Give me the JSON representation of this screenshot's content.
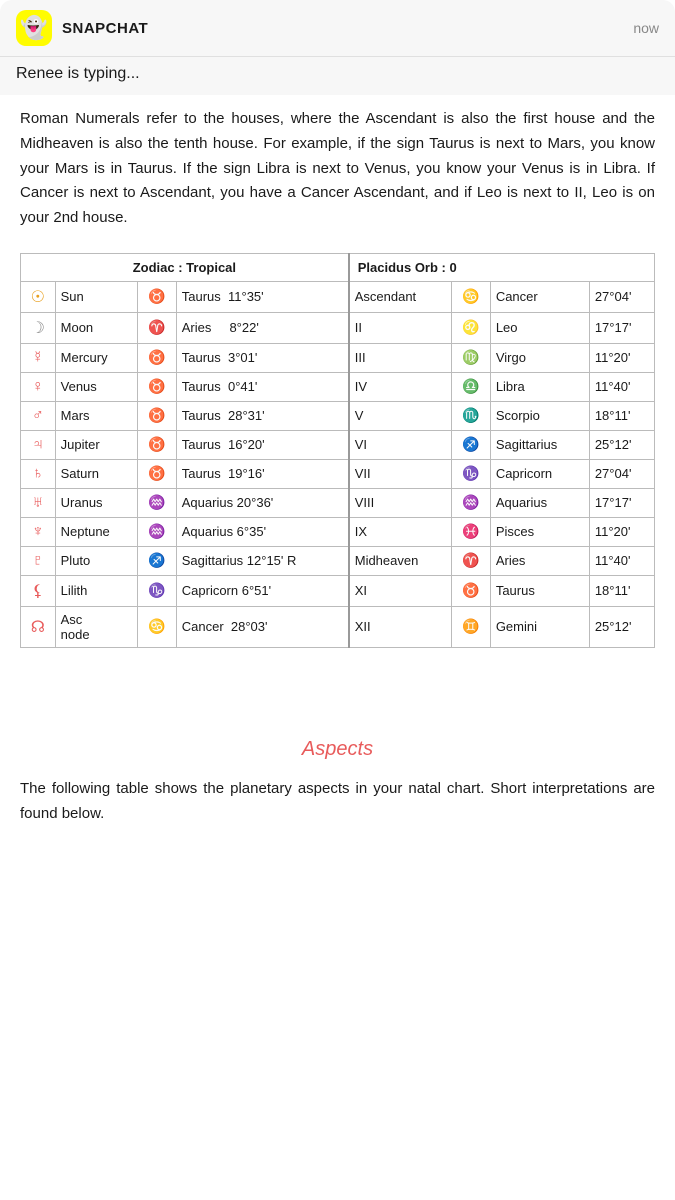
{
  "notification": {
    "app": "SNAPCHAT",
    "time": "now",
    "message": "Renee is typing...",
    "icon": "👻"
  },
  "intro_text": "Roman Numerals refer to the houses, where the Ascendant is also the first house and the Midheaven is also the tenth house. For example, if the sign Taurus is next to Mars, you know your Mars is in Taurus. If the sign Libra is next to Venus, you know your Venus is in Libra. If Cancer is next to Ascendant, you have a Cancer Ascendant, and if Leo is next to II, Leo is on your 2nd house.",
  "table": {
    "left_header": "Zodiac : Tropical",
    "right_header": "Placidus Orb : 0",
    "planets": [
      {
        "symbol": "☉",
        "name": "Sun",
        "sign_sym": "♉",
        "sign": "Taurus",
        "degree": "11°35'",
        "color": "sun"
      },
      {
        "symbol": "☽",
        "name": "Moon",
        "sign_sym": "♈",
        "sign": "Aries",
        "degree": "8°22'",
        "color": "moon"
      },
      {
        "symbol": "☿",
        "name": "Mercury",
        "sign_sym": "♉",
        "sign": "Taurus",
        "degree": "3°01'",
        "color": "red"
      },
      {
        "symbol": "♀",
        "name": "Venus",
        "sign_sym": "♉",
        "sign": "Taurus",
        "degree": "0°41'",
        "color": "red"
      },
      {
        "symbol": "♂",
        "name": "Mars",
        "sign_sym": "♉",
        "sign": "Taurus",
        "degree": "28°31'",
        "color": "red"
      },
      {
        "symbol": "♃",
        "name": "Jupiter",
        "sign_sym": "♉",
        "sign": "Taurus",
        "degree": "16°20'",
        "color": "red"
      },
      {
        "symbol": "♄",
        "name": "Saturn",
        "sign_sym": "♉",
        "sign": "Taurus",
        "degree": "19°16'",
        "color": "red"
      },
      {
        "symbol": "⛢",
        "name": "Uranus",
        "sign_sym": "♒",
        "sign": "Aquarius",
        "degree": "20°36'",
        "color": "red"
      },
      {
        "symbol": "♆",
        "name": "Neptune",
        "sign_sym": "♒",
        "sign": "Aquarius",
        "degree": "6°35'",
        "color": "red"
      },
      {
        "symbol": "♇",
        "name": "Pluto",
        "sign_sym": "♐",
        "sign": "Sagittarius",
        "degree": "12°15'",
        "retrograde": "R",
        "color": "red"
      },
      {
        "symbol": "⚸",
        "name": "Lilith",
        "sign_sym": "♑",
        "sign": "Capricorn",
        "degree": "6°51'",
        "color": "red"
      },
      {
        "symbol": "☊",
        "name": "Asc node",
        "sign_sym": "♋",
        "sign": "Cancer",
        "degree": "28°03'",
        "color": "red"
      }
    ],
    "houses": [
      {
        "name": "Ascendant",
        "sign_sym": "♋",
        "sign": "Cancer",
        "degree": "27°04'",
        "color": "green"
      },
      {
        "name": "II",
        "sign_sym": "♌",
        "sign": "Leo",
        "degree": "17°17'",
        "color": "red"
      },
      {
        "name": "III",
        "sign_sym": "♍",
        "sign": "Virgo",
        "degree": "11°20'",
        "color": "red"
      },
      {
        "name": "IV",
        "sign_sym": "♎",
        "sign": "Libra",
        "degree": "11°40'",
        "color": "red"
      },
      {
        "name": "V",
        "sign_sym": "♏",
        "sign": "Scorpio",
        "degree": "18°11'",
        "color": "red"
      },
      {
        "name": "VI",
        "sign_sym": "♐",
        "sign": "Sagittarius",
        "degree": "25°12'",
        "color": "red"
      },
      {
        "name": "VII",
        "sign_sym": "♑",
        "sign": "Capricorn",
        "degree": "27°04'",
        "color": "red"
      },
      {
        "name": "VIII",
        "sign_sym": "♒",
        "sign": "Aquarius",
        "degree": "17°17'",
        "color": "red"
      },
      {
        "name": "IX",
        "sign_sym": "♓",
        "sign": "Pisces",
        "degree": "11°20'",
        "color": "red"
      },
      {
        "name": "Midheaven",
        "sign_sym": "♈",
        "sign": "Aries",
        "degree": "11°40'",
        "color": "red"
      },
      {
        "name": "XI",
        "sign_sym": "♉",
        "sign": "Taurus",
        "degree": "18°11'",
        "color": "red"
      },
      {
        "name": "XII",
        "sign_sym": "♊",
        "sign": "Gemini",
        "degree": "25°12'",
        "color": "red"
      }
    ]
  },
  "aspects": {
    "title": "Aspects",
    "text": "The following table shows the planetary aspects in your natal chart. Short interpretations are found below."
  }
}
